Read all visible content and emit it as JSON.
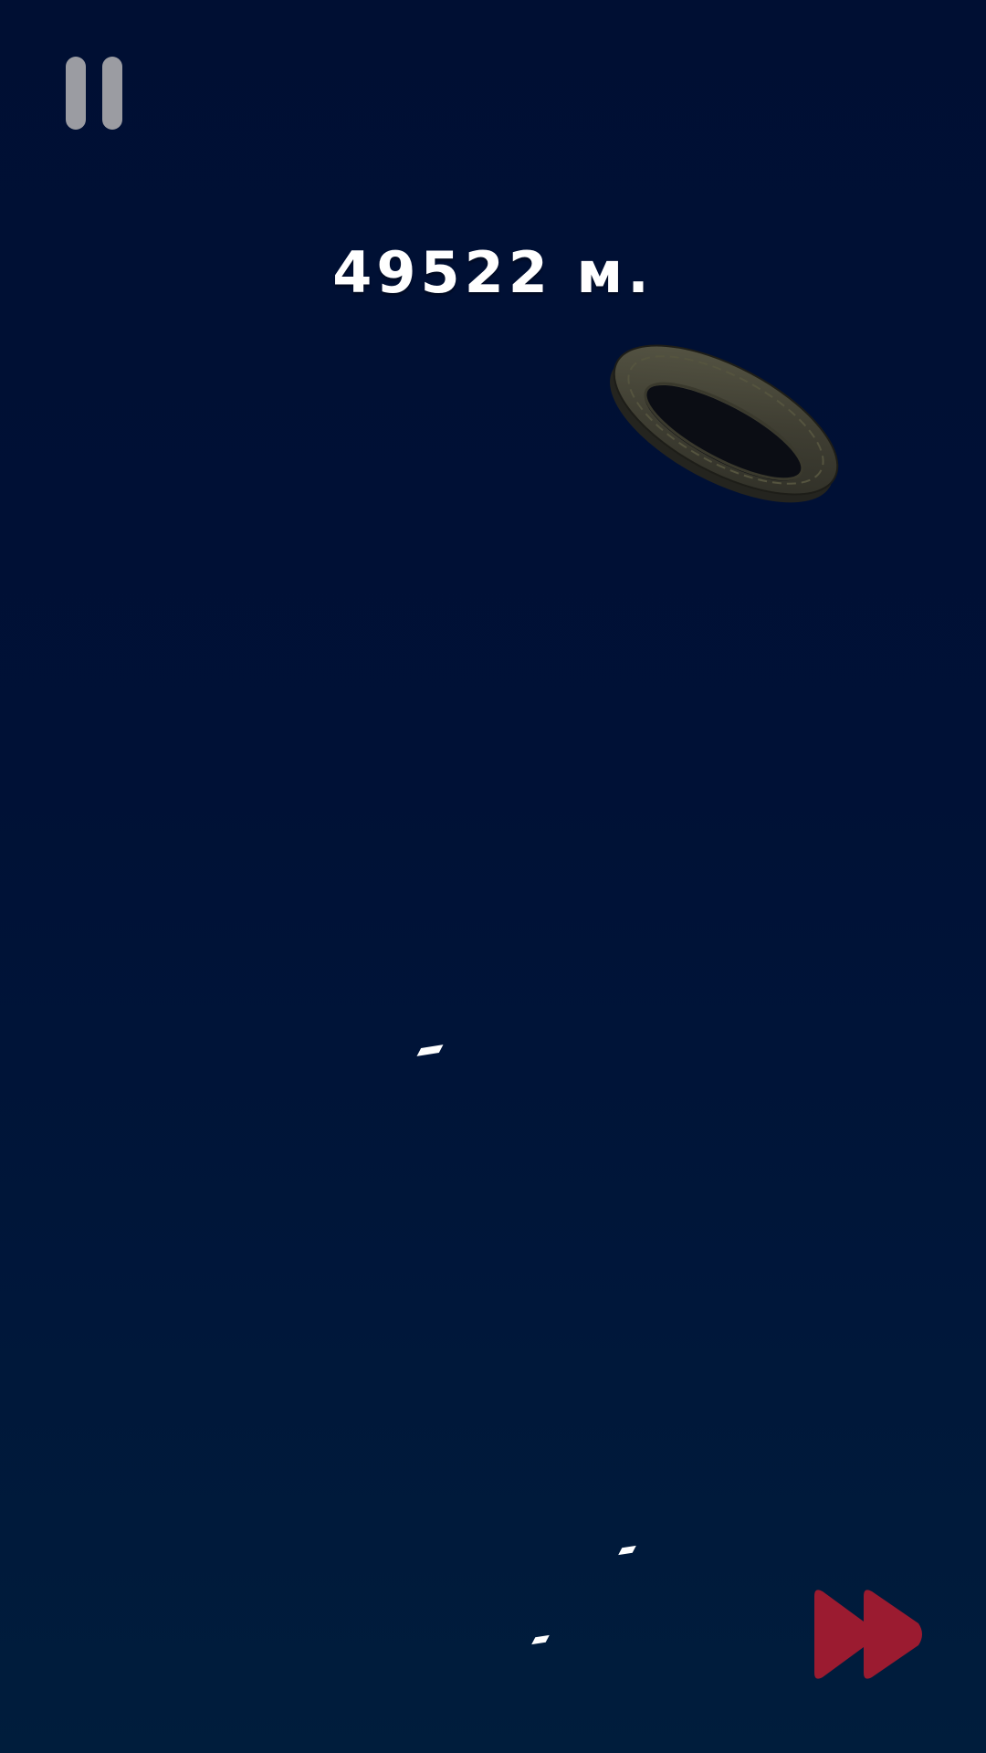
{
  "hud": {
    "distance_text": "49522 м."
  },
  "controls": {
    "pause_icon": "pause-icon",
    "fast_forward_icon": "fast-forward-icon"
  },
  "colors": {
    "background_top": "#000f33",
    "background_bottom": "#001d3c",
    "pause_icon": "#9b9ca2",
    "fast_forward_icon": "#9b1b30",
    "distance_text": "#ffffff"
  },
  "objects": {
    "falling_object": "tire"
  }
}
